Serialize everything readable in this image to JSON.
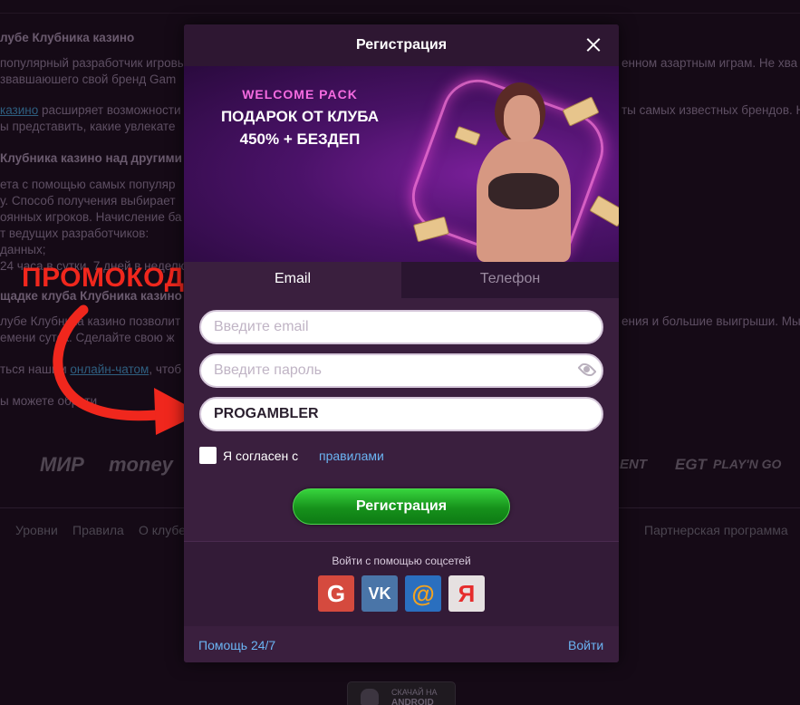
{
  "background": {
    "lines": [
      {
        "text": "лубе Клубника казино",
        "bold": true
      },
      {
        "text": "популярный разработчик игровых"
      },
      {
        "text": "звавшаюшего свой бренд Gam"
      },
      {
        "text": "казино",
        "link": true
      },
      {
        "text": " расширяет возможности"
      },
      {
        "text": "ы представить, какие увлекате"
      },
      {
        "text": "Клубника казино над другими",
        "bold": true
      },
      {
        "text": "ета с помощью самых популяр"
      },
      {
        "text": "у. Способ получения выбирает"
      },
      {
        "text": "оянных игроков. Начисление ба"
      },
      {
        "text": "т ведущих разработчиков:"
      },
      {
        "text": "данных;"
      },
      {
        "text": "24 часа в сутки, 7 дней в неделю"
      },
      {
        "text": "щадке клуба Клубника казино",
        "bold": true
      },
      {
        "text": "лубе Клубника казино позволит"
      },
      {
        "text": "емени суток. Сделайте свою ж"
      },
      {
        "text": "ться нашим "
      },
      {
        "text": "онлайн-чатом",
        "link": true
      },
      {
        "text": ", чтоб"
      },
      {
        "text": "ы можете обрати"
      }
    ],
    "right_lines": [
      "енном азартным играм. Не хва",
      "ты самых известных брендов. Н",
      "ения и большие выигрыши. Мы"
    ],
    "logos": [
      "МИР",
      "money",
      "ENT",
      "EGT",
      "PLAY'N GO"
    ],
    "footer_nav": [
      "Уровни",
      "Правила",
      "О клубе",
      "Партнерская программа"
    ],
    "app_badge": {
      "line1": "СКАЧАЙ НА",
      "line2": "ANDROID"
    }
  },
  "annotation": {
    "label": "ПРОМОКОД"
  },
  "modal": {
    "title": "Регистрация",
    "banner": {
      "welcome": "WELCOME PACK",
      "line1": "ПОДАРОК ОТ КЛУБА",
      "line2": "450% + БЕЗДЕП"
    },
    "tabs": [
      "Email",
      "Телефон"
    ],
    "email_placeholder": "Введите email",
    "password_placeholder": "Введите пароль",
    "promo_value": "PROGAMBLER",
    "agree_text": "Я согласен с",
    "rules_link": "правилами",
    "register_button": "Регистрация",
    "social_title": "Войти с помощью соцсетей",
    "social": [
      {
        "icon": "google-icon",
        "glyph": "G"
      },
      {
        "icon": "vk-icon",
        "glyph": "VK"
      },
      {
        "icon": "mail-icon",
        "glyph": "@"
      },
      {
        "icon": "yandex-icon",
        "glyph": "Я"
      }
    ],
    "help_link": "Помощь 24/7",
    "login_link": "Войти"
  },
  "colors": {
    "modal_bg": "#3a1f3e",
    "accent_green": "#16911b",
    "link_blue": "#6bb4f3",
    "annotation_red": "#f0271d"
  }
}
